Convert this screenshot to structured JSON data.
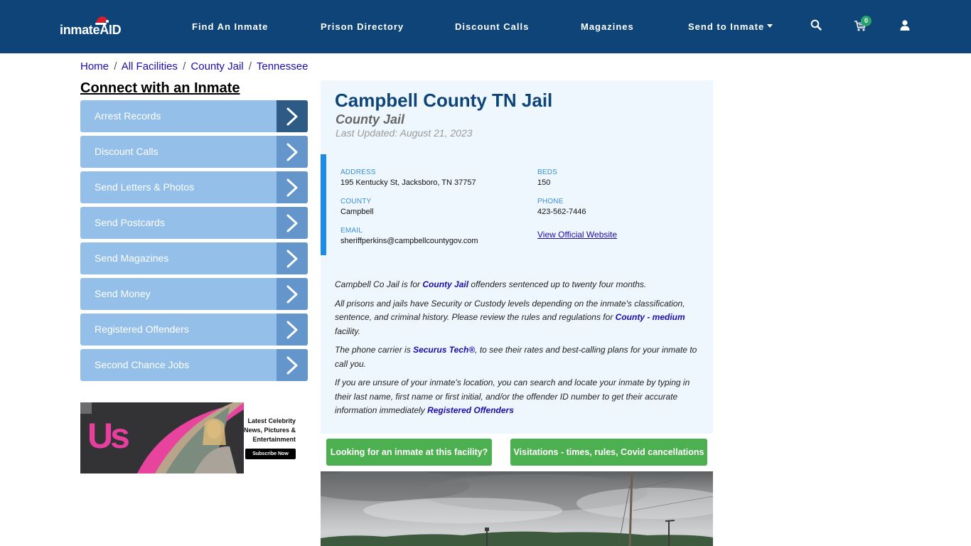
{
  "header": {
    "logo_text_1": "inmate",
    "logo_text_2": "AID",
    "nav": [
      {
        "label": "Find An Inmate"
      },
      {
        "label": "Prison Directory"
      },
      {
        "label": "Discount Calls"
      },
      {
        "label": "Magazines"
      },
      {
        "label": "Send to Inmate",
        "has_dropdown": true
      }
    ],
    "icons": [
      "search-icon",
      "cart-icon",
      "user-icon"
    ],
    "cart_count": "0"
  },
  "breadcrumb": [
    {
      "label": "Home"
    },
    {
      "label": "All Facilities"
    },
    {
      "label": "County Jail"
    },
    {
      "label": "Tennessee"
    }
  ],
  "breadcrumb_separator": "/",
  "sidebar": {
    "title": "Connect with an Inmate",
    "items": [
      {
        "label": "Arrest Records"
      },
      {
        "label": "Discount Calls"
      },
      {
        "label": "Send Letters & Photos"
      },
      {
        "label": "Send Postcards"
      },
      {
        "label": "Send Magazines"
      },
      {
        "label": "Send Money"
      },
      {
        "label": "Registered Offenders"
      },
      {
        "label": "Second Chance Jobs"
      }
    ]
  },
  "ad": {
    "brand": "Us",
    "headline_lines": [
      "Latest Celebrity",
      "News, Pictures &",
      "Entertainment"
    ],
    "cta": "Subscribe Now"
  },
  "facility": {
    "name": "Campbell County TN Jail",
    "type": "County Jail",
    "last_updated": "Last Updated: August 21, 2023",
    "address_label": "ADDRESS",
    "address": "195 Kentucky St, Jacksboro, TN 37757",
    "beds_label": "BEDS",
    "beds": "150",
    "county_label": "COUNTY",
    "county": "Campbell",
    "phone_label": "PHONE",
    "phone": "423-562-7446",
    "email_label": "EMAIL",
    "email": "sheriffperkins@campbellcountygov.com",
    "website_link": "View Official Website"
  },
  "description": {
    "p1_pre": "Campbell Co Jail is for ",
    "p1_link": "County Jail",
    "p1_post": " offenders sentenced up to twenty four months.",
    "p2_pre": "All prisons and jails have Security or Custody levels depending on the inmate's classification, sentence, and criminal history. Please review the rules and regulations for ",
    "p2_link": "County - medium",
    "p2_post": " facility.",
    "p3_pre": "The phone carrier is ",
    "p3_link": "Securus Tech®",
    "p3_post": ", to see their rates and best-calling plans for your inmate to call you.",
    "p4_pre": "If you are unsure of your inmate's location, you can search and locate your inmate by typing in their last name, first name or first initial, and/or the offender ID number to get their accurate information immediately ",
    "p4_link": "Registered Offenders"
  },
  "buttons": {
    "find_inmate": "Looking for an inmate at this facility?",
    "visitations": "Visitations - times, rules, Covid cancellations"
  },
  "colors": {
    "header_bg": "#0e4478",
    "sidebar_item": "#94bfe8",
    "sidebar_arrow": "#6496cb",
    "sidebar_arrow_active": "#2e5a86",
    "panel_bg": "#eef7fe",
    "accent_bar": "#1a8ce8",
    "green_button": "#4caf50",
    "link": "#1a0dab"
  }
}
